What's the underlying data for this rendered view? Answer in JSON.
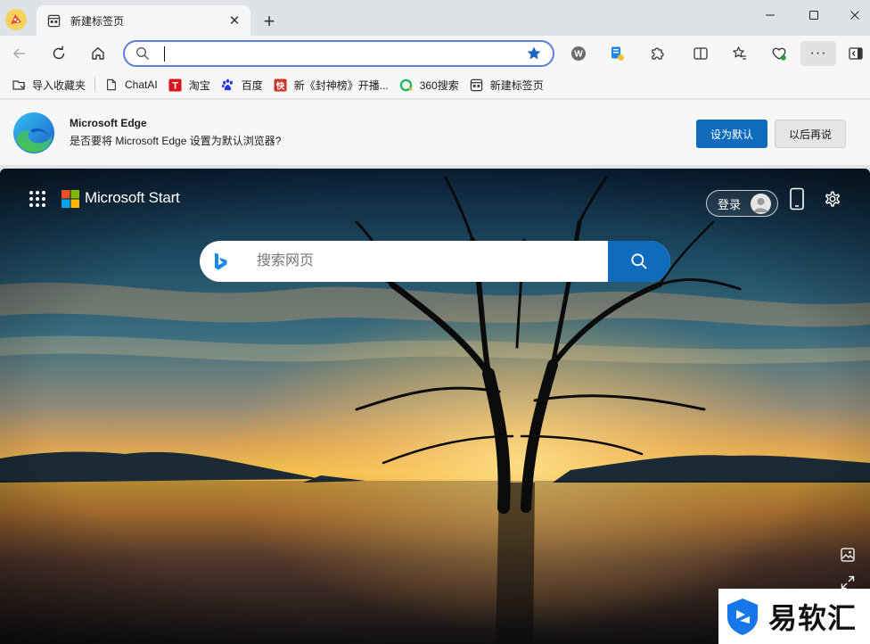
{
  "tab": {
    "title": "新建标签页"
  },
  "addressbar": {
    "value": "",
    "placeholder": ""
  },
  "favorites": [
    {
      "label": "导入收藏夹",
      "icon": "import-favorites-icon"
    },
    {
      "label": "ChatAI",
      "icon": "page-icon"
    },
    {
      "label": "淘宝",
      "icon": "taobao-icon"
    },
    {
      "label": "百度",
      "icon": "baidu-icon"
    },
    {
      "label": "新《封神榜》开播...",
      "icon": "news-icon"
    },
    {
      "label": "360搜索",
      "icon": "360-search-icon"
    },
    {
      "label": "新建标签页",
      "icon": "new-tab-page-icon"
    }
  ],
  "banner": {
    "title": "Microsoft Edge",
    "text": "是否要将 Microsoft Edge 设置为默认浏览器?",
    "primary": "设为默认",
    "secondary": "以后再说"
  },
  "ntp": {
    "brand": "Microsoft Start",
    "login": "登录",
    "search_placeholder": "搜索网页"
  },
  "watermark": {
    "text": "易软汇"
  },
  "colors": {
    "accent": "#0f6cbd",
    "address_border": "#5b7fd6",
    "chrome": "#dfe3e8"
  }
}
